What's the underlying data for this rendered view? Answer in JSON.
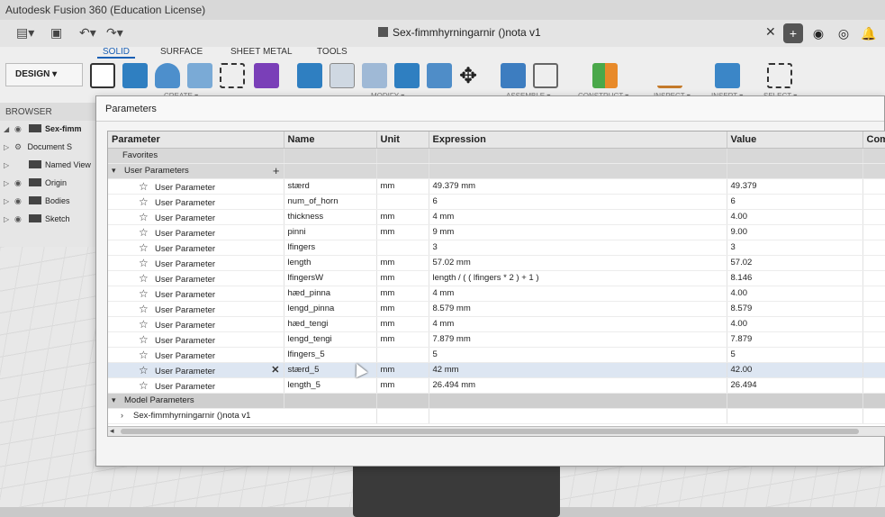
{
  "app": {
    "title": "Autodesk Fusion 360 (Education License)"
  },
  "document_tab": {
    "name": "Sex-fimmhyrningarnir ()nota v1"
  },
  "workspace": {
    "label": "DESIGN"
  },
  "ribbon": {
    "tabs": [
      "SOLID",
      "SURFACE",
      "SHEET METAL",
      "TOOLS"
    ],
    "active_tab": "SOLID",
    "groups": [
      "CREATE ▾",
      "MODIFY ▾",
      "ASSEMBLE ▾",
      "CONSTRUCT ▾",
      "INSPECT ▾",
      "INSERT ▾",
      "SELECT ▾"
    ]
  },
  "browser": {
    "header": "BROWSER",
    "items": [
      {
        "label": "Sex-fimm",
        "icon": "document-icon"
      },
      {
        "label": "Document S",
        "icon": "gear-icon"
      },
      {
        "label": "Named View",
        "icon": "folder-icon"
      },
      {
        "label": "Origin",
        "icon": "folder-icon"
      },
      {
        "label": "Bodies",
        "icon": "folder-icon"
      },
      {
        "label": "Sketch",
        "icon": "folder-icon"
      }
    ]
  },
  "dialog": {
    "title": "Parameters",
    "columns": [
      "Parameter",
      "Name",
      "Unit",
      "Expression",
      "Value",
      "Com"
    ],
    "favorites_label": "Favorites",
    "user_params_label": "User Parameters",
    "model_params_label": "Model Parameters",
    "model_child_label": "Sex-fimmhyrningarnir ()nota v1",
    "rows": [
      {
        "param": "User Parameter",
        "name": "stærd",
        "unit": "mm",
        "expr": "49.379 mm",
        "value": "49.379"
      },
      {
        "param": "User Parameter",
        "name": "num_of_horn",
        "unit": "",
        "expr": "6",
        "value": "6"
      },
      {
        "param": "User Parameter",
        "name": "thickness",
        "unit": "mm",
        "expr": "4 mm",
        "value": "4.00"
      },
      {
        "param": "User Parameter",
        "name": "pinni",
        "unit": "mm",
        "expr": "9 mm",
        "value": "9.00"
      },
      {
        "param": "User Parameter",
        "name": "lfingers",
        "unit": "",
        "expr": "3",
        "value": "3"
      },
      {
        "param": "User Parameter",
        "name": "length",
        "unit": "mm",
        "expr": "57.02 mm",
        "value": "57.02"
      },
      {
        "param": "User Parameter",
        "name": "lfingersW",
        "unit": "mm",
        "expr": "length / ( ( lfingers * 2 ) + 1 )",
        "value": "8.146"
      },
      {
        "param": "User Parameter",
        "name": "hæd_pinna",
        "unit": "mm",
        "expr": "4 mm",
        "value": "4.00"
      },
      {
        "param": "User Parameter",
        "name": "lengd_pinna",
        "unit": "mm",
        "expr": "8.579 mm",
        "value": "8.579"
      },
      {
        "param": "User Parameter",
        "name": "hæd_tengi",
        "unit": "mm",
        "expr": "4 mm",
        "value": "4.00"
      },
      {
        "param": "User Parameter",
        "name": "lengd_tengi",
        "unit": "mm",
        "expr": "7.879 mm",
        "value": "7.879"
      },
      {
        "param": "User Parameter",
        "name": "lfingers_5",
        "unit": "",
        "expr": "5",
        "value": "5"
      },
      {
        "param": "User Parameter",
        "name": "stærd_5",
        "unit": "mm",
        "expr": "42 mm",
        "value": "42.00",
        "selected": true
      },
      {
        "param": "User Parameter",
        "name": "length_5",
        "unit": "mm",
        "expr": "26.494 mm",
        "value": "26.494"
      }
    ]
  }
}
